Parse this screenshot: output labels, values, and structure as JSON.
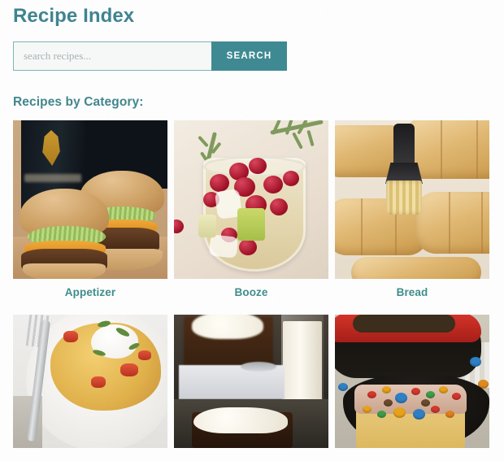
{
  "page": {
    "title": "Recipe Index",
    "background_color": "#fdfdfd"
  },
  "theme": {
    "title_color": "#3f8490",
    "section_title_color": "#41868c",
    "category_label_color": "#3f8e8a",
    "button_color": "#3f8a92",
    "input_border_color": "#7fb2b6",
    "input_background": "#f6f8f8",
    "placeholder_color": "#a8b0b0",
    "button_text_color": "#ffffff"
  },
  "search": {
    "placeholder": "search recipes...",
    "value": "",
    "button_label": "SEARCH"
  },
  "section": {
    "heading": "Recipes by Category:"
  },
  "categories": [
    {
      "label": "Appetizer",
      "image_alt": "Guinness beef sliders with pickles and cheddar on pretzel buns"
    },
    {
      "label": "Booze",
      "image_alt": "Cranberry rosemary white sangria cocktail in a stemless glass"
    },
    {
      "label": "Bread",
      "image_alt": "Golden dinner rolls being brushed with melted butter"
    },
    {
      "label": "",
      "image_alt": "Mexican corn casserole with sour cream, tomato and cilantro on a white plate"
    },
    {
      "label": "",
      "image_alt": "Chocolate sheet cake with white frosting and a glass of milk"
    },
    {
      "label": "",
      "image_alt": "Candy topped chocolate cake slice on a dark skillet beside a red baking dish"
    }
  ]
}
